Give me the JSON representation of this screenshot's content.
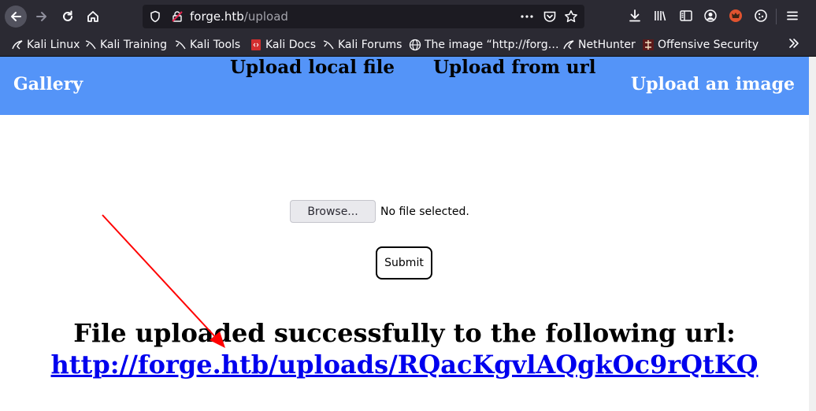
{
  "browser": {
    "url_host": "forge.htb",
    "url_path": "/upload",
    "bookmarks": [
      {
        "label": "Kali Linux",
        "icon": "kali-dragon-icon"
      },
      {
        "label": "Kali Training",
        "icon": "kali-dragon-icon"
      },
      {
        "label": "Kali Tools",
        "icon": "kali-dragon-icon"
      },
      {
        "label": "Kali Docs",
        "icon": "kali-docs-icon"
      },
      {
        "label": "Kali Forums",
        "icon": "kali-dragon-icon"
      },
      {
        "label": "The image “http://forg…",
        "icon": "globe-icon"
      },
      {
        "label": "NetHunter",
        "icon": "kali-dragon-icon"
      },
      {
        "label": "Offensive Security",
        "icon": "offsec-icon"
      }
    ]
  },
  "site": {
    "brand": "Gallery",
    "upload_link": "Upload an image",
    "tabs": {
      "local": "Upload local file",
      "url": "Upload from url"
    },
    "browse_label": "Browse...",
    "file_status": "No file selected.",
    "submit_label": "Submit",
    "success_message": "File uploaded successfully to the following url:",
    "uploaded_url": "http://forge.htb/uploads/RQacKgvlAQgkOc9rQtKQ"
  },
  "colors": {
    "header": "#5494f8",
    "link": "#0000ee",
    "annotation_arrow": "#ff0000",
    "chrome_bg": "#2b2a33"
  }
}
